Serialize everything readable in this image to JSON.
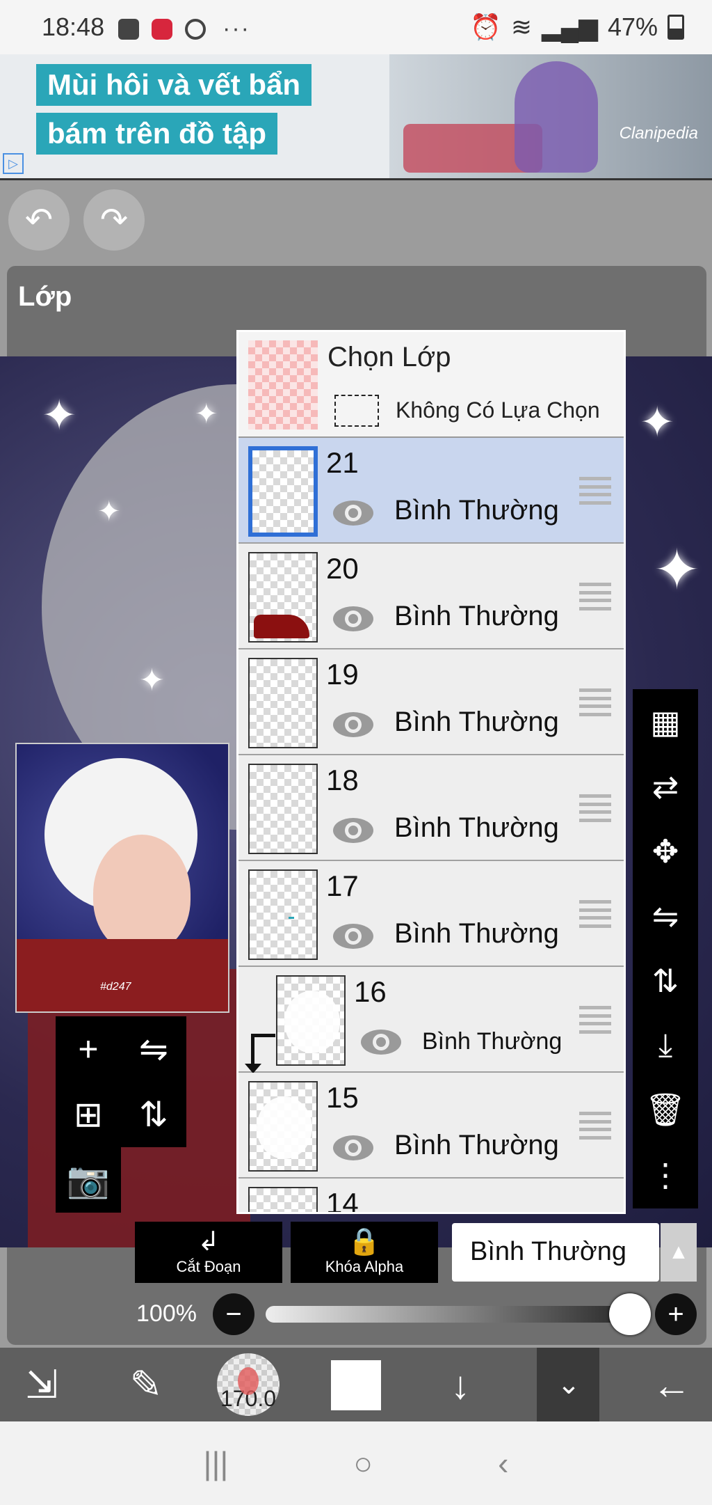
{
  "status_bar": {
    "time": "18:48",
    "left_icons": [
      "gallery-icon",
      "record-icon",
      "compass-icon"
    ],
    "more": "···",
    "battery": "47%",
    "right_icons": [
      "alarm-icon",
      "wifi-icon",
      "signal-icon",
      "signal-icon-2",
      "battery-icon"
    ]
  },
  "ad": {
    "line1": "Mùi hôi và vết bẩn",
    "line2": "bám trên đồ tập",
    "brand": "Clanipedia"
  },
  "top_buttons": {
    "undo": "↶",
    "redo": "↷"
  },
  "panel": {
    "title": "Lớp"
  },
  "selection_layer": {
    "title": "Chọn Lớp",
    "subtitle": "Không Có Lựa Chọn"
  },
  "layers": [
    {
      "number": "21",
      "mode": "Bình Thường",
      "selected": true,
      "thumb": "empty"
    },
    {
      "number": "20",
      "mode": "Bình Thường",
      "selected": false,
      "thumb": "red-blob"
    },
    {
      "number": "19",
      "mode": "Bình Thường",
      "selected": false,
      "thumb": "empty"
    },
    {
      "number": "18",
      "mode": "Bình Thường",
      "selected": false,
      "thumb": "empty"
    },
    {
      "number": "17",
      "mode": "Bình Thường",
      "selected": false,
      "thumb": "dot"
    },
    {
      "number": "16",
      "mode": "Bình Thường",
      "selected": false,
      "thumb": "ghost",
      "clipped": true
    },
    {
      "number": "15",
      "mode": "Bình Thường",
      "selected": false,
      "thumb": "ghost"
    },
    {
      "number": "14",
      "mode": "",
      "partial": true
    }
  ],
  "left_tools": {
    "add": "+",
    "flip": "⇋",
    "add_copy": "⊞",
    "flip_vertical": "⇅",
    "camera": "📷"
  },
  "right_tools": [
    "transparency-icon",
    "swap-icon",
    "move-icon",
    "flip-horizontal-icon",
    "flip-vertical-icon",
    "merge-down-icon",
    "trash-icon",
    "more-vertical-icon"
  ],
  "bottom_controls": {
    "clip_label": "Cắt Đoạn",
    "alpha_lock_label": "Khóa Alpha",
    "blend_mode": "Bình Thường",
    "opacity_label": "100%",
    "opacity_value": 1.0
  },
  "main_toolbar": {
    "brush_size": "170.0",
    "color": "#ffffff"
  },
  "navbar": {
    "recent": "|||",
    "home": "○",
    "back": "‹"
  }
}
